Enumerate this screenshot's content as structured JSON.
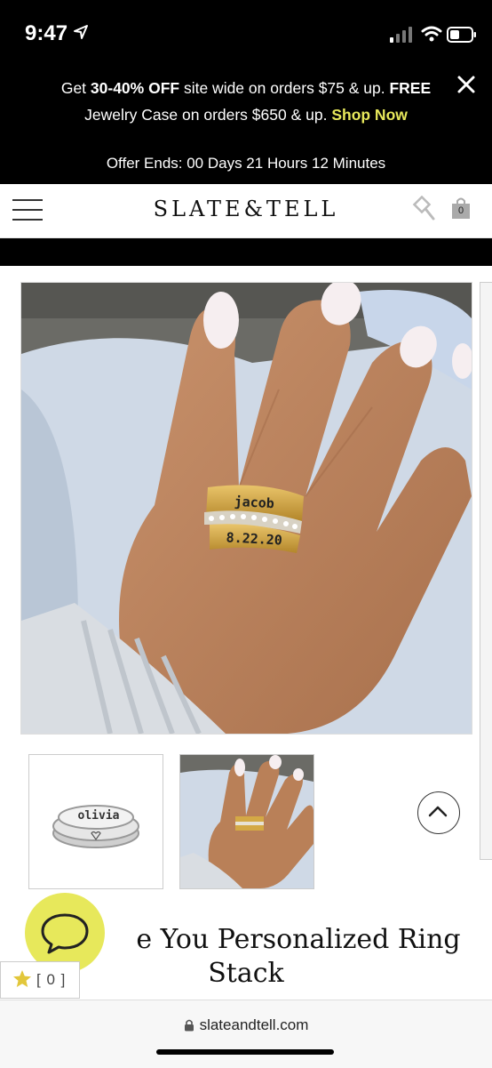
{
  "status_bar": {
    "time": "9:47"
  },
  "promo": {
    "line_prefix": "Get ",
    "discount": "30-40% OFF",
    "line_mid": " site wide on orders $75 & up. ",
    "free": "FREE",
    "line_end": " Jewelry Case on orders $650 & up. ",
    "shop_now": "Shop Now",
    "offer_ends": "Offer Ends: 00 Days 21 Hours 12 Minutes"
  },
  "header": {
    "logo": "SLATE&TELL",
    "cart_count": "0"
  },
  "product": {
    "title_line1": "e You Personalized Ring",
    "title_line2": "Stack",
    "main_ring_engraving_top": "jacob",
    "main_ring_engraving_bottom": "8.22.20",
    "thumb1_engraving": "olivia"
  },
  "rating": {
    "label": "[ 0 ]"
  },
  "browser": {
    "url": "slateandtell.com"
  },
  "colors": {
    "accent_yellow": "#e7e85b",
    "promo_bg": "#000000"
  }
}
